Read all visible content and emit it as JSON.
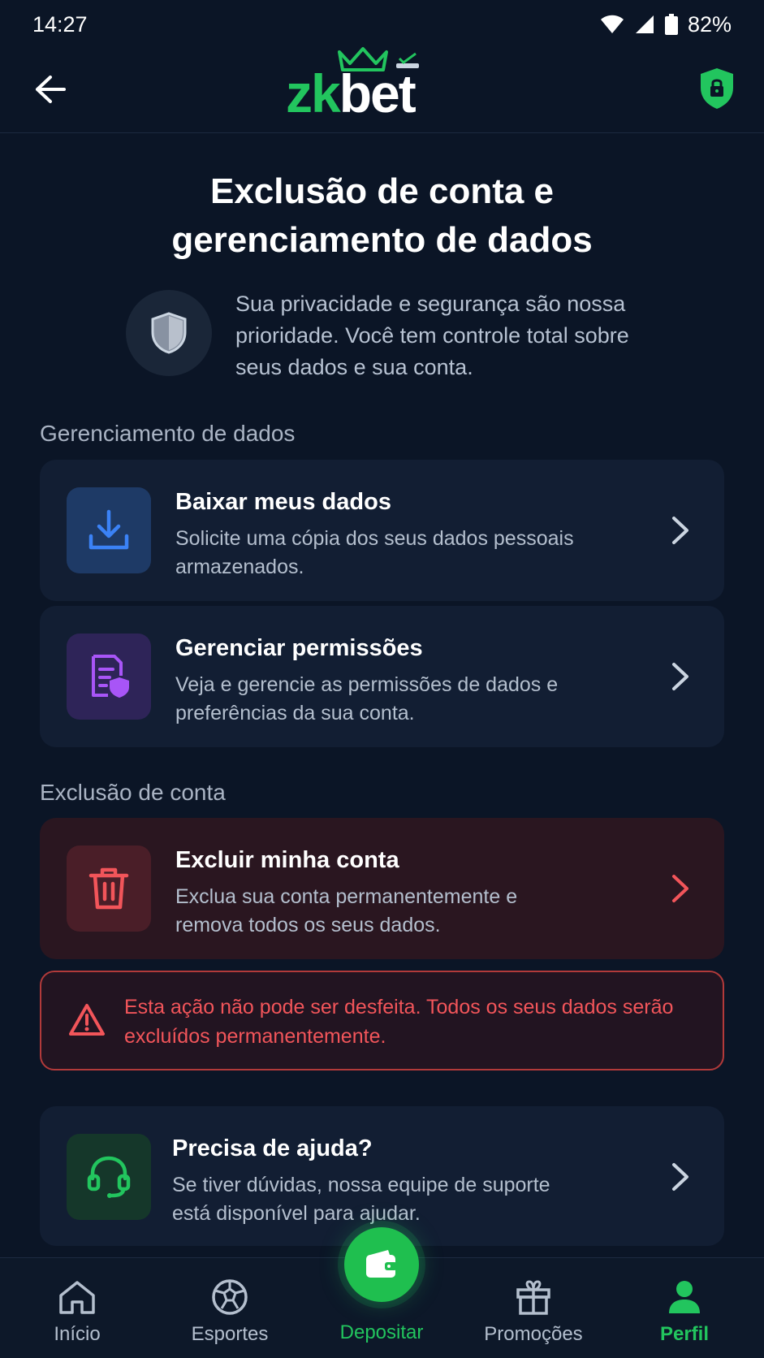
{
  "status_bar": {
    "time": "14:27",
    "battery": "82%"
  },
  "header": {
    "logo_zk": "zk",
    "logo_bet": "bet"
  },
  "page": {
    "title_line1": "Exclusão de conta e",
    "title_line2": "gerenciamento de dados",
    "intro": "Sua privacidade e segurança são nossa prioridade. Você tem controle total sobre seus dados e sua conta."
  },
  "sections": {
    "data_management": "Gerenciamento de dados",
    "account_deletion": "Exclusão de conta"
  },
  "cards": {
    "download": {
      "title": "Baixar meus dados",
      "description": "Solicite uma cópia dos seus dados pessoais armazenados."
    },
    "permissions": {
      "title": "Gerenciar permissões",
      "description": "Veja e gerencie as permissões de dados e preferências da sua conta."
    },
    "delete": {
      "title": "Excluir minha conta",
      "description": "Exclua sua conta permanentemente e remova todos os seus dados."
    },
    "help": {
      "title": "Precisa de ajuda?",
      "description": "Se tiver dúvidas, nossa equipe de suporte está disponível para ajudar."
    }
  },
  "warning": "Esta ação não pode ser desfeita. Todos os seus dados serão excluídos permanentemente.",
  "bottom_nav": {
    "home": "Início",
    "sports": "Esportes",
    "deposit": "Depositar",
    "promotions": "Promoções",
    "profile": "Perfil",
    "active": "profile"
  },
  "colors": {
    "background": "#0b1526",
    "card": "#121e33",
    "accent_green": "#22c55e",
    "danger_red": "#f2555a",
    "download_blue": "#3b82f6",
    "permissions_purple": "#a855f7"
  }
}
